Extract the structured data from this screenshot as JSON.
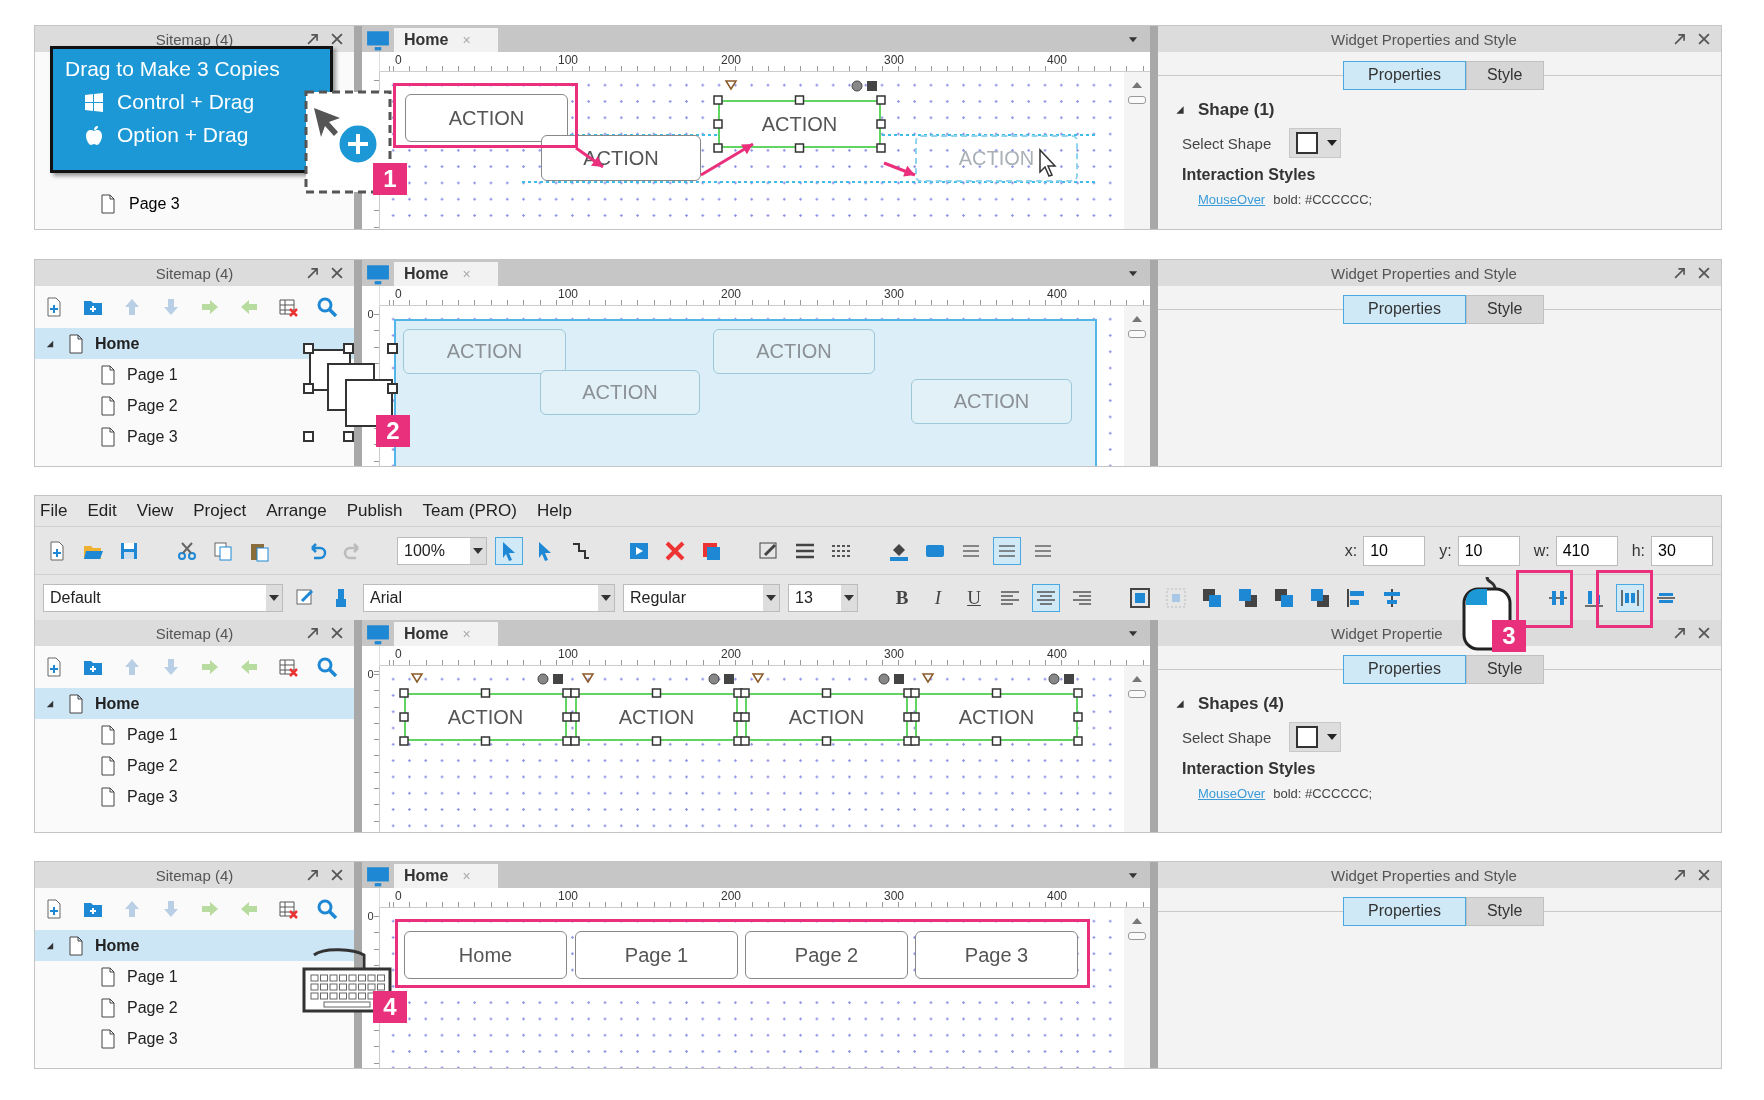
{
  "panels": [
    {
      "sitemap": {
        "title": "Sitemap (4)",
        "tree": [
          {
            "label": "Page 3",
            "selected": false
          }
        ]
      },
      "canvas": {
        "tab": "Home",
        "close": "×",
        "ruler": [
          "0",
          "100",
          "200",
          "300",
          "400"
        ],
        "widgets": [
          {
            "label": "ACTION",
            "kind": "normal",
            "selected": false
          },
          {
            "label": "ACTION",
            "kind": "normal",
            "selected": false
          },
          {
            "label": "ACTION",
            "kind": "normal",
            "selected": true
          },
          {
            "label": "ACTION",
            "kind": "ghost",
            "selected": false
          }
        ]
      },
      "properties": {
        "title": "Widget Properties and Style",
        "tabs": [
          {
            "label": "Properties",
            "selected": true
          },
          {
            "label": "Style",
            "selected": false
          }
        ],
        "section": {
          "title": "Shape (1)",
          "expanded": true,
          "field_label": "Select Shape",
          "subheading": "Interaction Styles",
          "style_event": "MouseOver",
          "style_value": "bold: #CCCCCC;"
        }
      },
      "tooltip": {
        "title": "Drag to Make 3 Copies",
        "lines": [
          {
            "kind": "windows",
            "text": "Control + Drag"
          },
          {
            "kind": "apple",
            "text": "Option + Drag"
          }
        ]
      },
      "callout": "1"
    },
    {
      "sitemap": {
        "title": "Sitemap (4)",
        "tree": [
          {
            "label": "Home",
            "selected": true,
            "expanded": true,
            "children": [
              {
                "label": "Page 1",
                "selected": false
              },
              {
                "label": "Page 2",
                "selected": false
              },
              {
                "label": "Page 3",
                "selected": false
              }
            ]
          }
        ]
      },
      "canvas": {
        "tab": "Home",
        "close": "×",
        "ruler": [
          "0",
          "100",
          "200",
          "300",
          "400"
        ],
        "vruler": "0",
        "selection_area": true,
        "widgets": [
          {
            "label": "ACTION",
            "kind": "highlighted",
            "selected": false
          },
          {
            "label": "ACTION",
            "kind": "highlighted",
            "selected": false
          },
          {
            "label": "ACTION",
            "kind": "highlighted",
            "selected": false
          },
          {
            "label": "ACTION",
            "kind": "highlighted",
            "selected": false
          }
        ]
      },
      "properties": {
        "title": "Widget Properties and Style",
        "tabs": [
          {
            "label": "Properties",
            "selected": true
          },
          {
            "label": "Style",
            "selected": false
          }
        ]
      },
      "callout": "2"
    },
    {
      "menu": [
        "File",
        "Edit",
        "View",
        "Project",
        "Arrange",
        "Publish",
        "Team (PRO)",
        "Help"
      ],
      "toolbar": {
        "zoom": "100%",
        "pointer_tools": [
          {
            "selected": true
          },
          {
            "selected": false
          },
          {
            "selected": false
          }
        ],
        "spacing_tools": [
          {
            "selected": false
          },
          {
            "selected": true
          },
          {
            "selected": false
          }
        ],
        "fields": [
          {
            "label": "x:",
            "value": "10"
          },
          {
            "label": "y:",
            "value": "10"
          },
          {
            "label": "w:",
            "value": "410"
          },
          {
            "label": "h:",
            "value": "30"
          }
        ],
        "style": "Default",
        "font": "Arial",
        "weight": "Regular",
        "size": "13",
        "format": [
          "B",
          "I",
          "U"
        ],
        "align": [
          {
            "selected": false
          },
          {
            "selected": true
          },
          {
            "selected": false
          }
        ],
        "distribute_tools": [
          {
            "selected": false
          },
          {
            "selected": false
          },
          {
            "selected": true
          },
          {
            "selected": false
          }
        ]
      },
      "sitemap": {
        "title": "Sitemap (4)",
        "tree": [
          {
            "label": "Home",
            "selected": true,
            "expanded": true,
            "children": [
              {
                "label": "Page 1",
                "selected": false
              },
              {
                "label": "Page 2",
                "selected": false
              },
              {
                "label": "Page 3",
                "selected": false
              }
            ]
          }
        ]
      },
      "canvas": {
        "tab": "Home",
        "close": "×",
        "ruler": [
          "0",
          "100",
          "200",
          "300",
          "400"
        ],
        "vruler": "0",
        "widgets": [
          {
            "label": "ACTION",
            "kind": "normal",
            "selected": true
          },
          {
            "label": "ACTION",
            "kind": "normal",
            "selected": true
          },
          {
            "label": "ACTION",
            "kind": "normal",
            "selected": true
          },
          {
            "label": "ACTION",
            "kind": "normal",
            "selected": true
          }
        ]
      },
      "properties": {
        "title": "Widget Propertie",
        "tabs": [
          {
            "label": "Properties",
            "selected": true
          },
          {
            "label": "Style",
            "selected": false
          }
        ],
        "section": {
          "title": "Shapes (4)",
          "expanded": true,
          "field_label": "Select Shape",
          "subheading": "Interaction Styles",
          "style_event": "MouseOver",
          "style_value": "bold: #CCCCCC;"
        }
      },
      "callout": "3"
    },
    {
      "sitemap": {
        "title": "Sitemap (4)",
        "tree": [
          {
            "label": "Home",
            "selected": true,
            "expanded": true,
            "children": [
              {
                "label": "Page 1",
                "selected": false
              },
              {
                "label": "Page 2",
                "selected": false
              },
              {
                "label": "Page 3",
                "selected": false
              }
            ]
          }
        ]
      },
      "canvas": {
        "tab": "Home",
        "close": "×",
        "ruler": [
          "0",
          "100",
          "200",
          "300",
          "400"
        ],
        "vruler": "0",
        "widgets": [
          {
            "label": "Home",
            "kind": "normal",
            "selected": false
          },
          {
            "label": "Page 1",
            "kind": "normal",
            "selected": false
          },
          {
            "label": "Page 2",
            "kind": "normal",
            "selected": false
          },
          {
            "label": "Page 3",
            "kind": "normal",
            "selected": false
          }
        ]
      },
      "properties": {
        "title": "Widget Properties and Style",
        "tabs": [
          {
            "label": "Properties",
            "selected": true
          },
          {
            "label": "Style",
            "selected": false
          }
        ]
      },
      "callout": "4"
    }
  ]
}
